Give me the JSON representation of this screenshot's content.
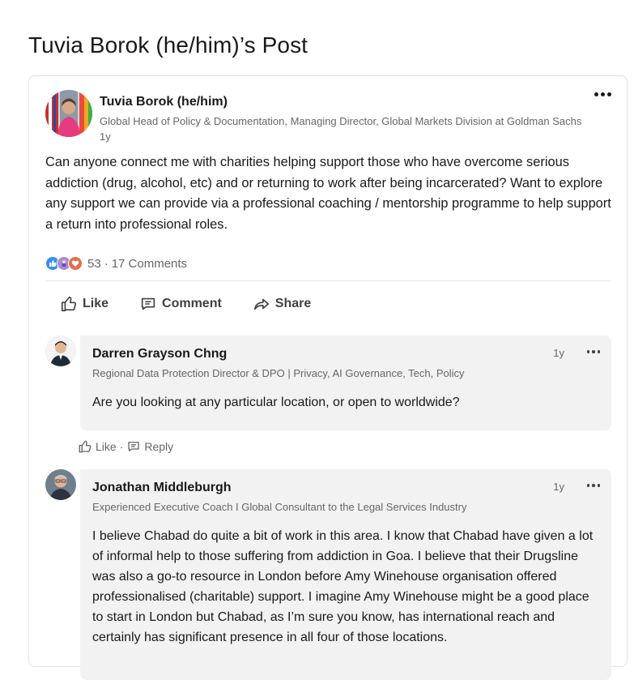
{
  "page": {
    "title": "Tuvia Borok (he/him)’s Post"
  },
  "post": {
    "author_name": "Tuvia Borok (he/him)",
    "author_headline": "Global Head of Policy & Documentation, Managing Director, Global Markets Division at Goldman Sachs",
    "time": "1y",
    "more_icon": "ellipsis-icon",
    "text": "Can anyone connect me with charities helping support those who have overcome serious addiction (drug, alcohol, etc) and or returning to work after being incarcerated? Want to explore any support we can provide via a professional coaching / mentorship programme to help support a return into professional roles.",
    "reaction_icons": [
      "like-reaction-icon",
      "celebrate-reaction-icon",
      "love-reaction-icon"
    ],
    "reaction_count": "53",
    "separator": "·",
    "comments_count": "17 Comments"
  },
  "actions": {
    "like": "Like",
    "comment": "Comment",
    "share": "Share"
  },
  "comments": [
    {
      "name": "Darren Grayson Chng",
      "headline": "Regional Data Protection Director & DPO | Privacy, AI Governance, Tech, Policy",
      "time": "1y",
      "text": "Are you looking at any particular location, or open to worldwide?",
      "like_label": "Like",
      "separator": "·",
      "reply_label": "Reply"
    },
    {
      "name": "Jonathan Middleburgh",
      "headline": "Experienced Executive Coach I Global Consultant to the Legal Services Industry",
      "time": "1y",
      "text": "I believe Chabad do quite a bit of work in this area. I know that Chabad have given a lot of informal help to those suffering from addiction in Goa.  I believe that their Drugsline was also a go-to resource in London before Amy Winehouse organisation offered professionalised (charitable) support. I imagine Amy Winehouse might be a good place to start in London but Chabad, as I’m sure you know, has international reach and certainly has significant presence in all four of those locations."
    }
  ],
  "colors": {
    "text": "#191919",
    "secondary_text": "#666666",
    "comment_bg": "#f2f2f2",
    "like_blue": "#378fe9",
    "love_orange": "#df704d"
  }
}
